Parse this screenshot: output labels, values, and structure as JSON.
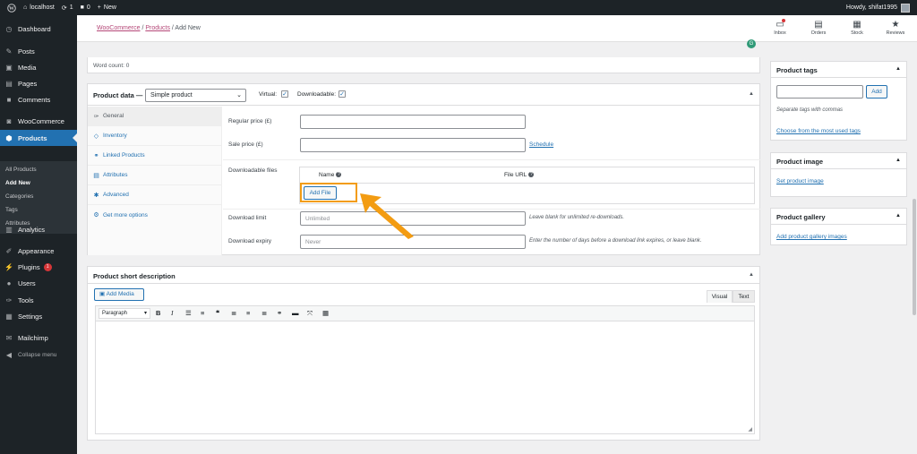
{
  "adminbar": {
    "site": "localhost",
    "updates": "1",
    "comments": "0",
    "new": "New",
    "howdy": "Howdy, shifat1995"
  },
  "sidebar": {
    "dashboard": "Dashboard",
    "posts": "Posts",
    "media": "Media",
    "pages": "Pages",
    "comments": "Comments",
    "woocommerce": "WooCommerce",
    "products": "Products",
    "sub": [
      "All Products",
      "Add New",
      "Categories",
      "Tags",
      "Attributes"
    ],
    "analytics": "Analytics",
    "appearance": "Appearance",
    "plugins": "Plugins",
    "plugins_badge": "1",
    "users": "Users",
    "tools": "Tools",
    "settings": "Settings",
    "mailchimp": "Mailchimp",
    "collapse": "Collapse menu"
  },
  "header": {
    "crumb_woocommerce": "WooCommerce",
    "crumb_products": "Products",
    "crumb_current": "Add New",
    "buttons": [
      "Inbox",
      "Orders",
      "Stock",
      "Reviews"
    ]
  },
  "word_count": "Word count: 0",
  "product_data": {
    "title": "Product data —",
    "type": "Simple product",
    "virtual_label": "Virtual:",
    "downloadable_label": "Downloadable:",
    "tabs": [
      "General",
      "Inventory",
      "Linked Products",
      "Attributes",
      "Advanced",
      "Get more options"
    ],
    "regular_price_label": "Regular price (£)",
    "sale_price_label": "Sale price (£)",
    "schedule": "Schedule",
    "downloadable_files_label": "Downloadable files",
    "col_name": "Name",
    "col_file_url": "File URL",
    "add_file": "Add File",
    "download_limit_label": "Download limit",
    "download_limit_placeholder": "Unlimited",
    "download_limit_desc": "Leave blank for unlimited re-downloads.",
    "download_expiry_label": "Download expiry",
    "download_expiry_placeholder": "Never",
    "download_expiry_desc": "Enter the number of days before a download link expires, or leave blank."
  },
  "short_description": {
    "title": "Product short description",
    "add_media": "Add Media",
    "visual": "Visual",
    "text": "Text",
    "paragraph": "Paragraph"
  },
  "product_tags": {
    "title": "Product tags",
    "add": "Add",
    "hint": "Separate tags with commas",
    "choose": "Choose from the most used tags"
  },
  "product_image": {
    "title": "Product image",
    "set": "Set product image"
  },
  "product_gallery": {
    "title": "Product gallery",
    "add": "Add product gallery images"
  },
  "colors": {
    "accent": "#2271b1",
    "highlight": "#f39c12",
    "wc_link": "#b54878"
  }
}
